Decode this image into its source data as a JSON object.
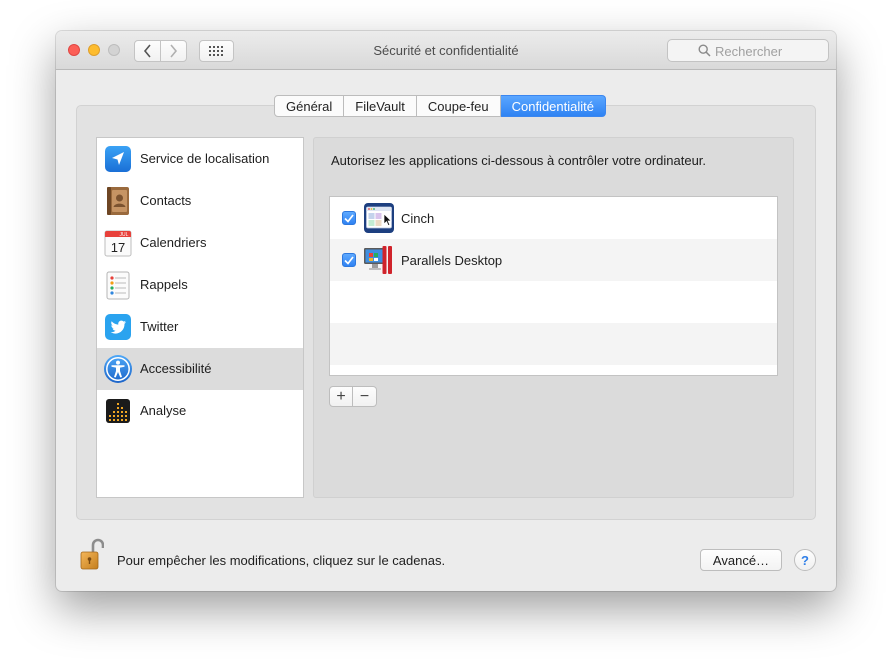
{
  "window": {
    "title": "Sécurité et confidentialité"
  },
  "search": {
    "placeholder": "Rechercher"
  },
  "tabs": [
    {
      "label": "Général",
      "active": false
    },
    {
      "label": "FileVault",
      "active": false
    },
    {
      "label": "Coupe-feu",
      "active": false
    },
    {
      "label": "Confidentialité",
      "active": true
    }
  ],
  "sidebar": {
    "items": [
      {
        "label": "Service de localisation",
        "icon": "location-arrow-icon",
        "selected": false
      },
      {
        "label": "Contacts",
        "icon": "contacts-book-icon",
        "selected": false
      },
      {
        "label": "Calendriers",
        "icon": "calendar-icon",
        "selected": false,
        "icon_month": "JUL",
        "icon_day": "17"
      },
      {
        "label": "Rappels",
        "icon": "reminders-list-icon",
        "selected": false
      },
      {
        "label": "Twitter",
        "icon": "twitter-bird-icon",
        "selected": false
      },
      {
        "label": "Accessibilité",
        "icon": "accessibility-icon",
        "selected": true
      },
      {
        "label": "Analyse",
        "icon": "analytics-grid-icon",
        "selected": false
      }
    ]
  },
  "panel": {
    "intro": "Autorisez les applications ci-dessous à contrôler votre ordinateur.",
    "apps": [
      {
        "name": "Cinch",
        "checked": true,
        "icon": "cinch-app-icon"
      },
      {
        "name": "Parallels Desktop",
        "checked": true,
        "icon": "parallels-desktop-icon"
      }
    ],
    "add_label": "+",
    "remove_label": "−"
  },
  "footer": {
    "lock_text": "Pour empêcher les modifications, cliquez sur le cadenas.",
    "advanced_label": "Avancé…",
    "help_label": "?"
  },
  "colors": {
    "accent": "#2f83f3",
    "selection": "#dcdcdc",
    "close": "#fc5f57",
    "minimize": "#fdbc2e"
  }
}
